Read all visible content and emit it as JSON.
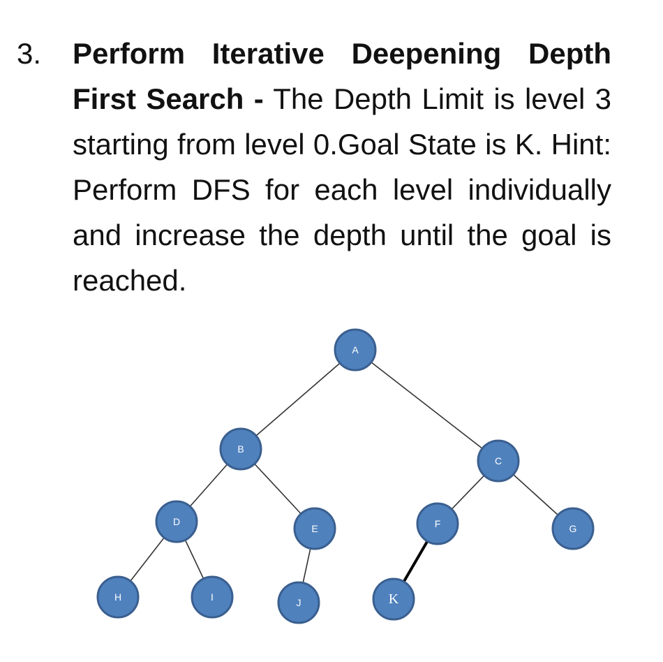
{
  "question": {
    "number": "3.",
    "title_bold": "Perform Iterative Deepening Depth First Search -",
    "text": " The Depth Limit is level 3 starting from level 0.Goal State is K. Hint: Perform DFS for each level individually and increase the depth until the goal is reached."
  },
  "tree": {
    "node_color": "#4f81bd",
    "node_border_color": "#3a5f8f",
    "goal": "K",
    "depth_limit": 3,
    "nodes": [
      {
        "id": "A",
        "label": "A",
        "level": 0
      },
      {
        "id": "B",
        "label": "B",
        "level": 1
      },
      {
        "id": "C",
        "label": "C",
        "level": 1
      },
      {
        "id": "D",
        "label": "D",
        "level": 2
      },
      {
        "id": "E",
        "label": "E",
        "level": 2
      },
      {
        "id": "F",
        "label": "F",
        "level": 2
      },
      {
        "id": "G",
        "label": "G",
        "level": 2
      },
      {
        "id": "H",
        "label": "H",
        "level": 3
      },
      {
        "id": "I",
        "label": "I",
        "level": 3
      },
      {
        "id": "J",
        "label": "J",
        "level": 3
      },
      {
        "id": "K",
        "label": "K",
        "level": 3
      }
    ],
    "edges": [
      {
        "from": "A",
        "to": "B"
      },
      {
        "from": "A",
        "to": "C"
      },
      {
        "from": "B",
        "to": "D"
      },
      {
        "from": "B",
        "to": "E"
      },
      {
        "from": "C",
        "to": "F"
      },
      {
        "from": "C",
        "to": "G"
      },
      {
        "from": "D",
        "to": "H"
      },
      {
        "from": "D",
        "to": "I"
      },
      {
        "from": "E",
        "to": "J"
      },
      {
        "from": "F",
        "to": "K",
        "emphasized": true
      }
    ]
  }
}
